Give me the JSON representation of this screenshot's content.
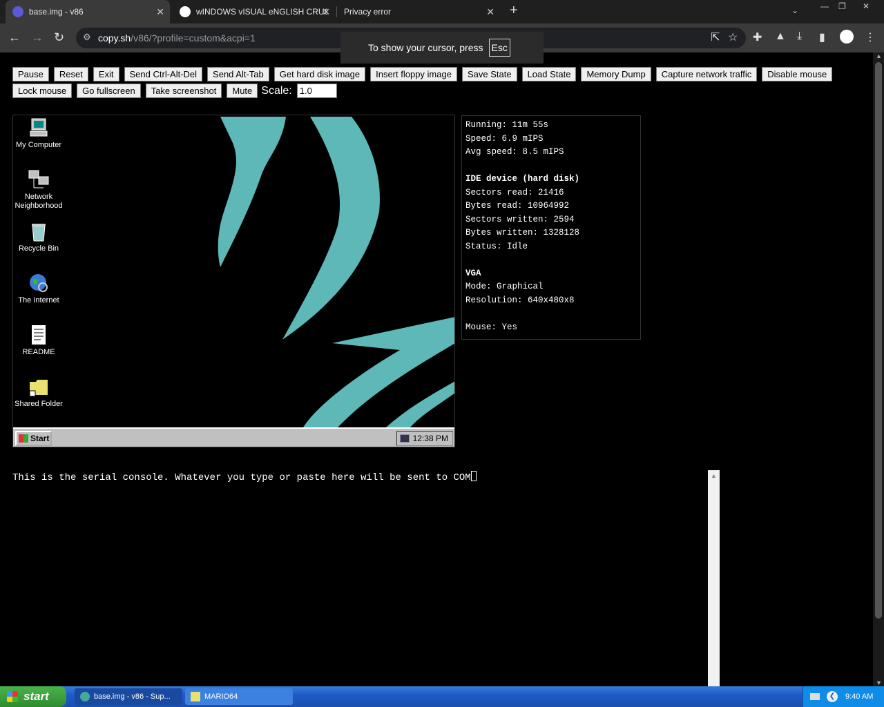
{
  "browser": {
    "tabs": [
      {
        "title": "base.img - v86",
        "active": true
      },
      {
        "title": "wINDOWS vISUAL eNGLISH CRUS",
        "active": false
      },
      {
        "title": "Privacy error",
        "active": false
      }
    ],
    "address": {
      "host": "copy.sh",
      "path": "/v86/?profile=custom&acpi=1"
    },
    "toast": {
      "text": "To show your cursor, press",
      "key": "Esc"
    }
  },
  "controls": {
    "row1": [
      "Pause",
      "Reset",
      "Exit",
      "Send Ctrl-Alt-Del",
      "Send Alt-Tab",
      "Get hard disk image",
      "Insert floppy image",
      "Save State",
      "Load State",
      "Memory Dump",
      "Capture network traffic",
      "Disable mouse"
    ],
    "row2": [
      "Lock mouse",
      "Go fullscreen",
      "Take screenshot",
      "Mute"
    ],
    "scale_label": "Scale:",
    "scale_value": "1.0"
  },
  "vm": {
    "desktop_icons": [
      {
        "label": "My Computer",
        "icon": "computer-icon"
      },
      {
        "label": "Network Neighborhood",
        "icon": "network-icon"
      },
      {
        "label": "Recycle Bin",
        "icon": "recycle-bin-icon"
      },
      {
        "label": "The Internet",
        "icon": "internet-globe-icon"
      },
      {
        "label": "README",
        "icon": "document-icon"
      },
      {
        "label": "Shared Folder",
        "icon": "folder-icon"
      }
    ],
    "start_label": "Start",
    "clock": "12:38 PM"
  },
  "info": {
    "running": "Running: 11m 55s",
    "speed": "Speed: 6.9 mIPS",
    "avg_speed": "Avg speed: 8.5 mIPS",
    "ide_header": "IDE device (hard disk)",
    "sectors_read": "Sectors read: 21416",
    "bytes_read": "Bytes read: 10964992",
    "sectors_written": "Sectors written: 2594",
    "bytes_written": "Bytes written: 1328128",
    "status": "Status: Idle",
    "vga_header": "VGA",
    "mode": "Mode: Graphical",
    "resolution": "Resolution: 640x480x8",
    "mouse": "Mouse: Yes"
  },
  "serial": {
    "text": "This is the serial console. Whatever you type or paste here will be sent to COM"
  },
  "os_taskbar": {
    "start_label": "start",
    "tasks": [
      {
        "label": "base.img - v86 - Sup..."
      },
      {
        "label": "MARIO64"
      }
    ],
    "clock": "9:40 AM"
  },
  "colors": {
    "accent_teal": "#5fb8b8",
    "xp_blue": "#1f5bc7",
    "xp_green": "#2e8b2e"
  }
}
